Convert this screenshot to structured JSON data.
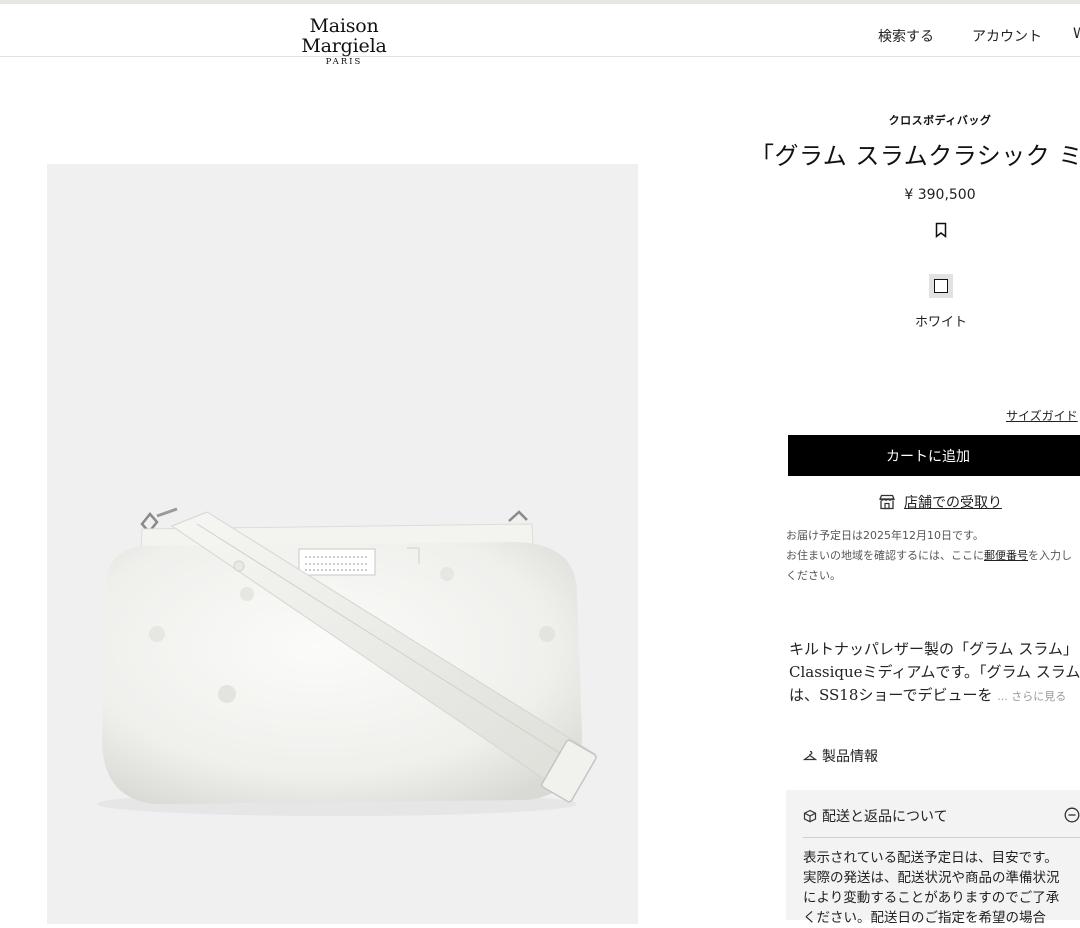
{
  "header": {
    "brand_name": "Maison Margiela",
    "brand_sub": "PARIS",
    "nav": {
      "search": "検索する",
      "account": "アカウント",
      "cut_item": "W"
    }
  },
  "product": {
    "category": "クロスボディバッグ",
    "title": "「グラム スラムクラシック ミデ",
    "price": "¥ 390,500",
    "color": {
      "name": "ホワイト",
      "swatch": "#ffffff"
    }
  },
  "actions": {
    "size_guide": "サイズガイド",
    "add_to_cart": "カートに追加",
    "store_pickup": "店舗での受取り"
  },
  "delivery": {
    "estimate": "お届け予定日は2025年12月10日です。",
    "line2_prefix": "お住まいの地域を確認するには、ここに",
    "postal_link": "郵便番号",
    "line2_suffix": "を入力し",
    "line3": "ください。"
  },
  "description": {
    "lines": [
      "キルトナッパレザー製の「グラム スラム」",
      "Classiqueミディアムです。「グラム スラム」",
      "は、SS18ショーでデビューを"
    ],
    "read_more": "... さらに見る"
  },
  "sections": {
    "product_info": "製品情報",
    "shipping_returns": "配送と返品について",
    "shipping_text": [
      "表示されている配送予定日は、目安です。",
      "実際の発送は、配送状況や商品の準備状況",
      "により変動することがありますのでご了承",
      "ください。配送日のご指定を希望の場合"
    ]
  },
  "colors": {
    "accent": "#000000",
    "panel": "#f3f3f3",
    "image_bg": "#f0f0f0"
  }
}
